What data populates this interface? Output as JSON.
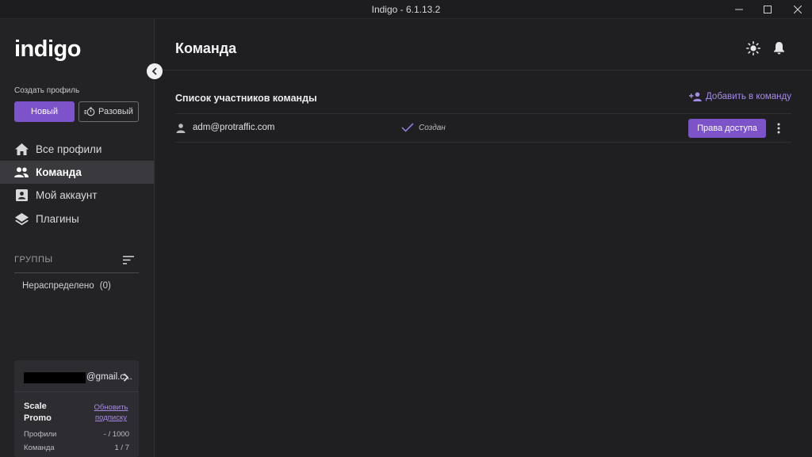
{
  "window": {
    "title": "Indigo - 6.1.13.2"
  },
  "sidebar": {
    "logo": "indigo",
    "create_label": "Создать профиль",
    "new_button": "Новый",
    "once_button": "Разовый",
    "nav": [
      {
        "label": "Все профили",
        "icon": "home-icon"
      },
      {
        "label": "Команда",
        "icon": "team-icon",
        "active": true
      },
      {
        "label": "Мой аккаунт",
        "icon": "account-icon"
      },
      {
        "label": "Плагины",
        "icon": "layers-icon"
      }
    ],
    "groups_label": "ГРУППЫ",
    "groups": [
      {
        "label": "Нераспределено",
        "count": "(0)"
      }
    ],
    "account": {
      "email_suffix": "@gmail.c...",
      "plan": "Scale Promo",
      "upgrade_link": "Обновить подписку",
      "stats": [
        {
          "label": "Профили",
          "value": "- / 1000"
        },
        {
          "label": "Команда",
          "value": "1 / 7"
        }
      ]
    }
  },
  "main": {
    "title": "Команда",
    "section_title": "Список участников команды",
    "add_label": "Добавить в команду",
    "members": [
      {
        "email": "adm@protraffic.com",
        "status": "Создан",
        "access_button": "Права доступа"
      }
    ]
  },
  "colors": {
    "accent": "#7c53c9",
    "link": "#a58ae8",
    "sidebar_bg": "#232326",
    "main_bg": "#1f1f22"
  }
}
